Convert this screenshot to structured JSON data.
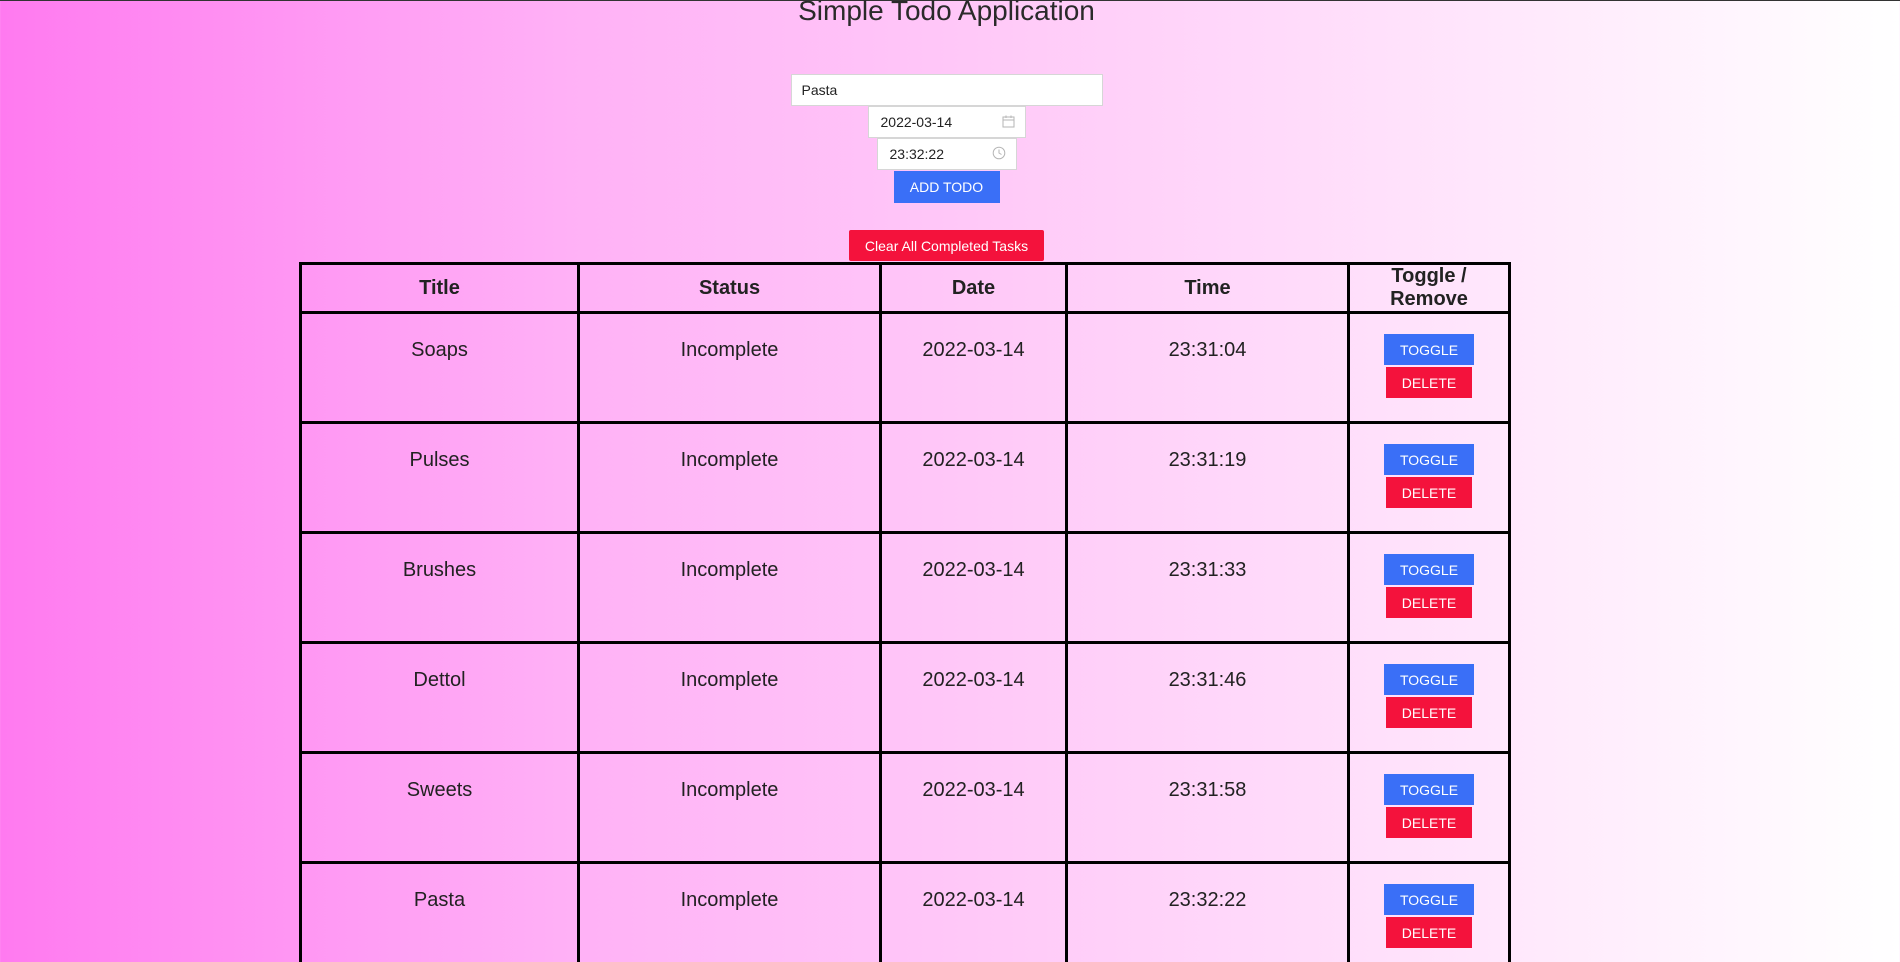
{
  "app": {
    "title": "Simple Todo Application"
  },
  "form": {
    "title_value": "Pasta",
    "date_value": "2022-03-14",
    "time_value": "23:32:22",
    "add_label": "ADD TODO"
  },
  "clear_label": "Clear All Completed Tasks",
  "table": {
    "headers": [
      "Title",
      "Status",
      "Date",
      "Time",
      "Toggle / Remove"
    ],
    "toggle_label": "TOGGLE",
    "delete_label": "DELETE",
    "rows": [
      {
        "title": "Soaps",
        "status": "Incomplete",
        "date": "2022-03-14",
        "time": "23:31:04"
      },
      {
        "title": "Pulses",
        "status": "Incomplete",
        "date": "2022-03-14",
        "time": "23:31:19"
      },
      {
        "title": "Brushes",
        "status": "Incomplete",
        "date": "2022-03-14",
        "time": "23:31:33"
      },
      {
        "title": "Dettol",
        "status": "Incomplete",
        "date": "2022-03-14",
        "time": "23:31:46"
      },
      {
        "title": "Sweets",
        "status": "Incomplete",
        "date": "2022-03-14",
        "time": "23:31:58"
      },
      {
        "title": "Pasta",
        "status": "Incomplete",
        "date": "2022-03-14",
        "time": "23:32:22"
      }
    ]
  },
  "colors": {
    "primary": "#3a6ff7",
    "danger": "#f4123c"
  }
}
